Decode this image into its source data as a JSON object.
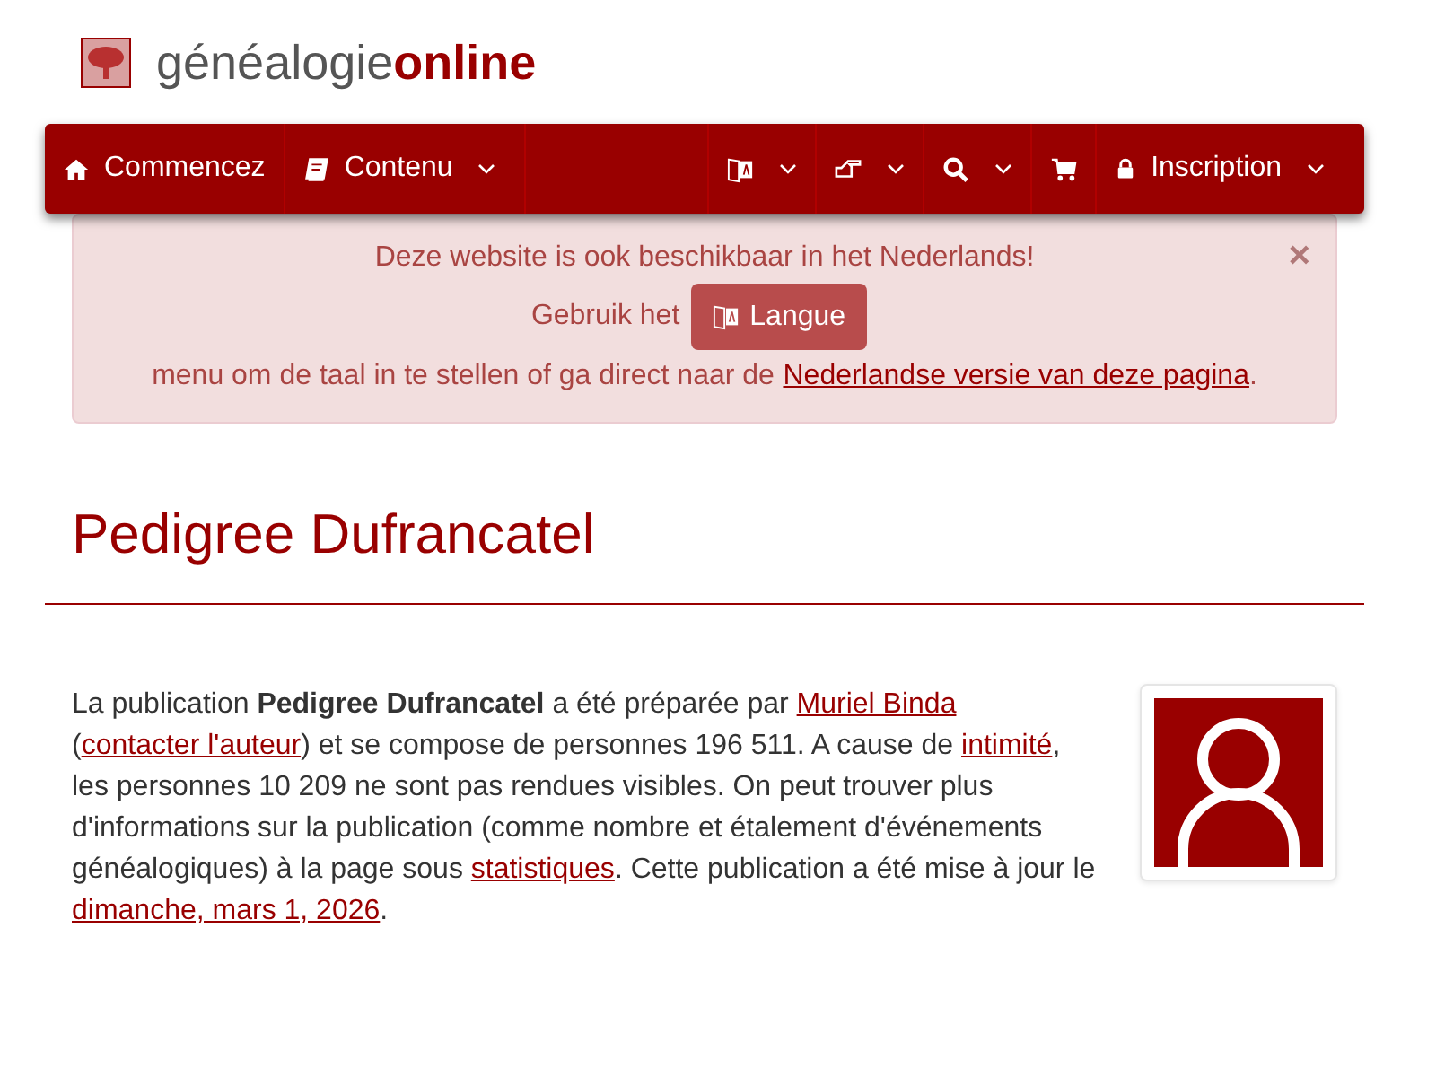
{
  "brand": {
    "name": "généalogie",
    "suffix": "online"
  },
  "nav": {
    "left": [
      {
        "kind": "home",
        "label": "Commencez",
        "dropdown": false
      },
      {
        "kind": "book",
        "label": "Contenu",
        "dropdown": true
      }
    ],
    "right": [
      {
        "kind": "translate",
        "dropdown": true
      },
      {
        "kind": "hand",
        "dropdown": true
      },
      {
        "kind": "search",
        "dropdown": true
      },
      {
        "kind": "cart",
        "dropdown": false
      },
      {
        "kind": "lock",
        "label": "Inscription",
        "dropdown": true
      }
    ]
  },
  "alert": {
    "close": "×",
    "title": "Deze website is ook beschikbaar in het Nederlands!",
    "before": "Gebruik het",
    "button": "Langue",
    "after": "menu om de taal in te stellen of ga direct naar de",
    "link": "Nederlandse versie van deze pagina",
    "end": "."
  },
  "heading": "Pedigree Dufrancatel",
  "intro": [
    {
      "kind": "text",
      "text": "La publication **Pedigree Dufrancatel** a été préparée par "
    },
    {
      "kind": "link",
      "text": "Muriel Binda"
    },
    {
      "kind": "text",
      "text": " ("
    },
    {
      "kind": "link",
      "text": "contacter l'auteur"
    },
    {
      "kind": "text",
      "text": ") et se compose de personnes 196 511. A cause de "
    },
    {
      "kind": "link",
      "text": "intimité"
    },
    {
      "kind": "text",
      "text": ", les personnes 10 209 ne sont pas rendues visibles. On peut trouver plus d'informations sur la publication (comme nombre et étalement d'événements généalogiques) à la page sous "
    },
    {
      "kind": "link",
      "text": "statistiques"
    },
    {
      "kind": "text",
      "text": ". Cette publication a été mise à jour le "
    },
    {
      "kind": "link",
      "text": "dimanche, mars 1, 2026"
    },
    {
      "kind": "text",
      "text": "."
    }
  ]
}
